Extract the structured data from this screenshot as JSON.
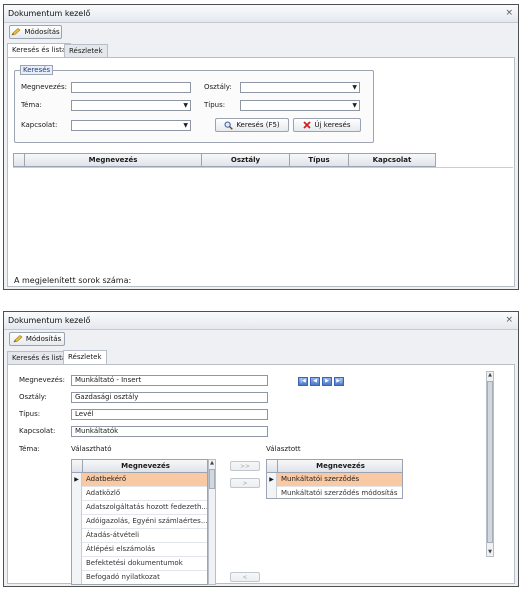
{
  "window1": {
    "title": "Dokumentum kezelő",
    "close": "×",
    "toolbar": {
      "edit_label": "Módosítás"
    },
    "tabs": [
      {
        "label": "Keresés és lista",
        "active": true
      },
      {
        "label": "Részletek",
        "active": false
      }
    ],
    "search_group": {
      "title": "Keresés",
      "megnevezes_label": "Megnevezés:",
      "megnevezes_value": "",
      "osztaly_label": "Osztály:",
      "osztaly_value": "",
      "tema_label": "Téma:",
      "tema_value": "",
      "tipus_label": "Típus:",
      "tipus_value": "",
      "kapcsolat_label": "Kapcsolat:",
      "kapcsolat_value": "",
      "search_button": "Keresés (F5)",
      "new_search_button": "Új keresés"
    },
    "grid": {
      "columns": [
        "Megnevezés",
        "Osztály",
        "Típus",
        "Kapcsolat"
      ]
    },
    "status_label": "A megjelenített sorok száma:"
  },
  "window2": {
    "title": "Dokumentum kezelő",
    "close": "×",
    "toolbar": {
      "edit_label": "Módosítás"
    },
    "tabs": [
      {
        "label": "Keresés és lista",
        "active": false
      },
      {
        "label": "Részletek",
        "active": true
      }
    ],
    "details": {
      "megnevezes_label": "Megnevezés:",
      "megnevezes_value": "Munkáltató - Insert",
      "osztaly_label": "Osztály:",
      "osztaly_value": "Gazdasági osztály",
      "tipus_label": "Típus:",
      "tipus_value": "Levél",
      "kapcsolat_label": "Kapcsolat:",
      "kapcsolat_value": "Munkáltatók",
      "tema_label": "Téma:"
    },
    "available": {
      "header": "Választható",
      "column": "Megnevezés",
      "items": [
        "Adatbekérő",
        "Adatközlő",
        "Adatszolgáltatás hozott fedezeth...",
        "Adóigazolás, Egyéni számlaértes...",
        "Átadás-átvételi",
        "Átlépési elszámolás",
        "Befektetési dokumentumok",
        "Befogadó nyilatkozat"
      ],
      "selected_index": 0
    },
    "chosen": {
      "header": "Választott",
      "column": "Megnevezés",
      "items": [
        "Munkáltatói szerződés",
        "Munkáltatói szerződés módosítás"
      ],
      "selected_index": 0
    },
    "move_buttons": {
      "add_all": ">>",
      "add_one": ">",
      "remove_one": "<"
    },
    "nav_buttons": {
      "first": "|◀",
      "prev": "◀",
      "next": "▶",
      "last": "▶|"
    }
  },
  "colors": {
    "selection": "#f9c9a4",
    "group_title": "#1f3c8a",
    "nav_blue": "#4c78c8"
  }
}
